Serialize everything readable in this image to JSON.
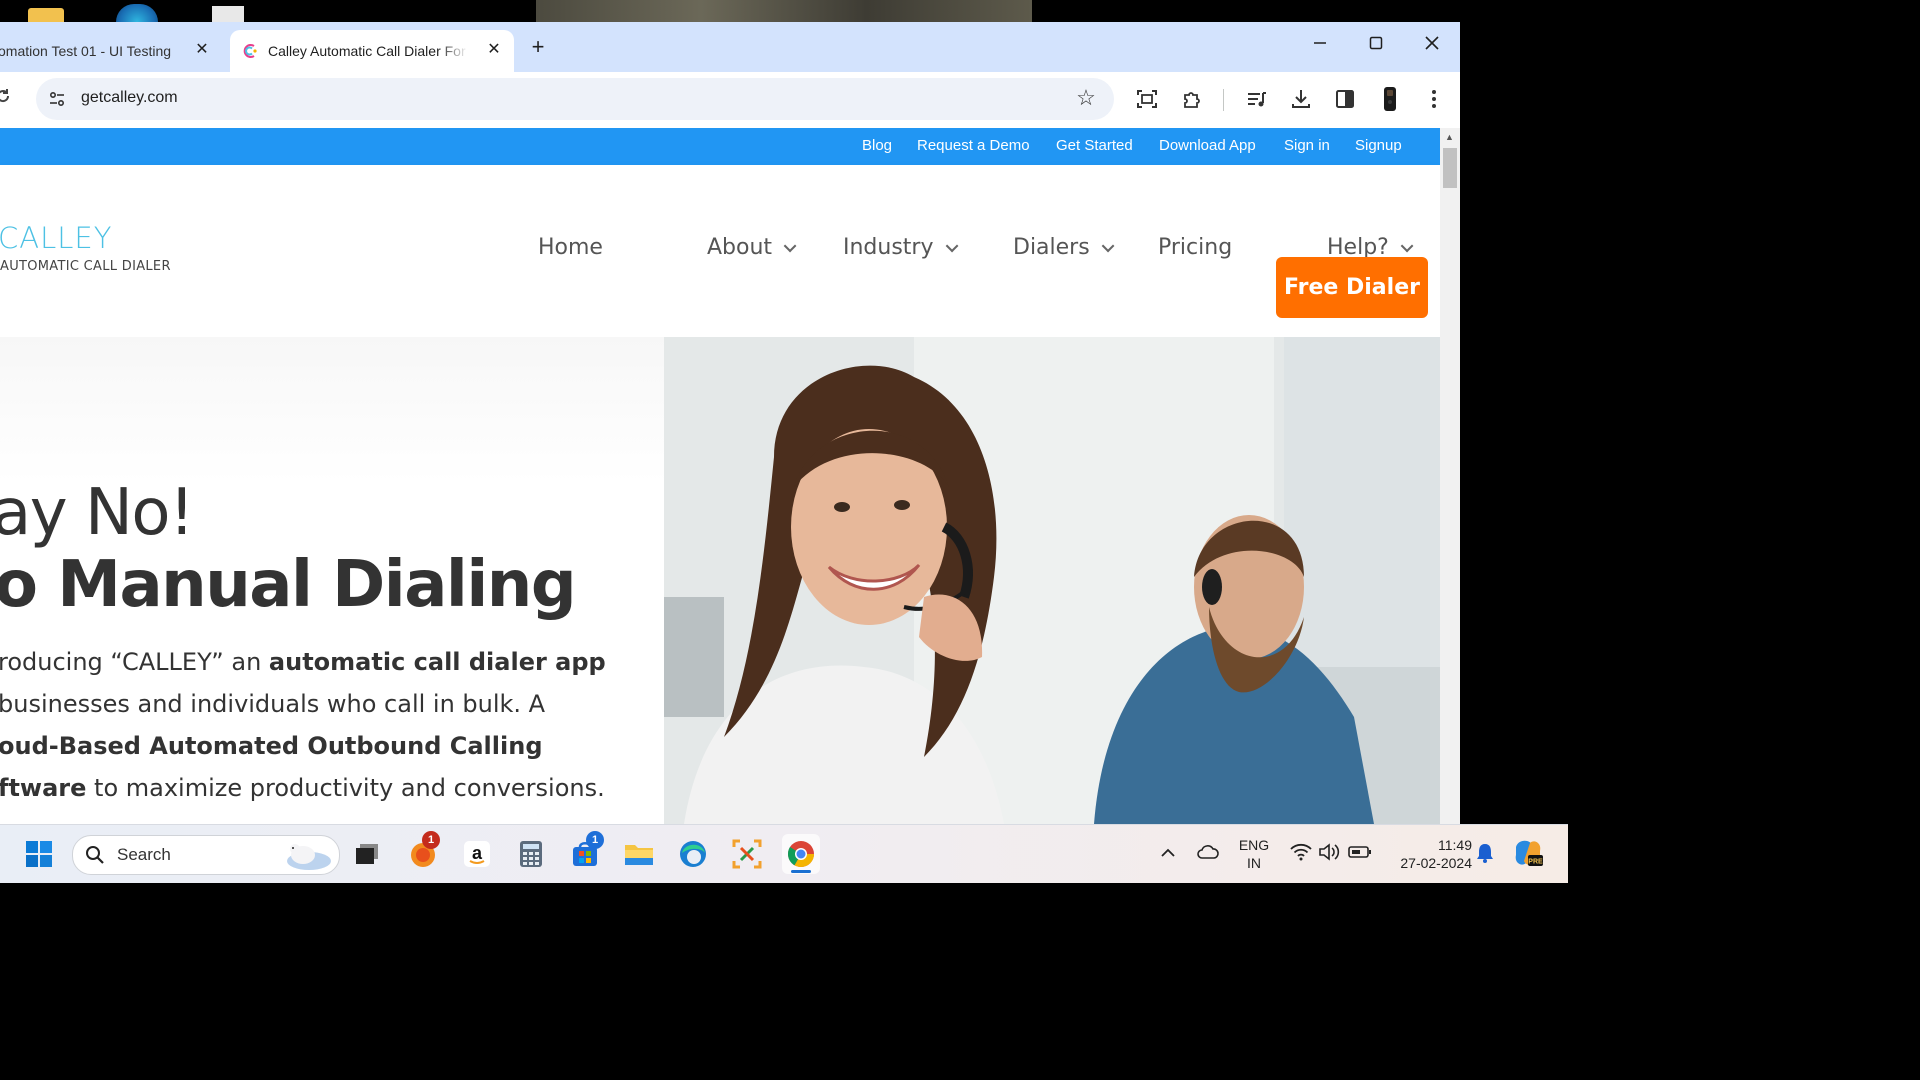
{
  "browser": {
    "tabs": [
      {
        "title": "omation Test 01 - UI Testing",
        "active": false
      },
      {
        "title": "Calley Automatic Call Dialer For",
        "active": true
      }
    ],
    "url": "getcalley.com"
  },
  "site": {
    "topbar_links": [
      "Blog",
      "Request a Demo",
      "Get Started",
      "Download App",
      "Sign in",
      "Signup"
    ],
    "logo": {
      "name": "CALLEY",
      "tagline": "AUTOMATIC CALL DIALER"
    },
    "nav": [
      {
        "label": "Home",
        "dropdown": false
      },
      {
        "label": "About",
        "dropdown": true
      },
      {
        "label": "Industry",
        "dropdown": true
      },
      {
        "label": "Dialers",
        "dropdown": true
      },
      {
        "label": "Pricing",
        "dropdown": false
      },
      {
        "label": "Help?",
        "dropdown": true
      }
    ],
    "cta": "Free Dialer",
    "hero": {
      "line1": "ay No!",
      "line2": "o Manual Dialing",
      "copy": {
        "l1_a": "roducing “CALLEY” an ",
        "l1_b": "automatic call dialer app",
        "l2": " businesses and individuals who call in bulk. A",
        "l3_b": "oud-Based Automated Outbound Calling",
        "l4_b": "ftware",
        "l4_a": " to maximize productivity and conversions."
      }
    }
  },
  "taskbar": {
    "search_placeholder": "Search",
    "badges": {
      "browser_app": "1",
      "store": "1"
    },
    "language": "ENG",
    "region": "IN",
    "time": "11:49",
    "date": "27-02-2024"
  },
  "colors": {
    "topbar": "#2196f3",
    "cta": "#ff6f00",
    "logo": "#4dc1e4",
    "tabbar": "#d3e3fd"
  }
}
